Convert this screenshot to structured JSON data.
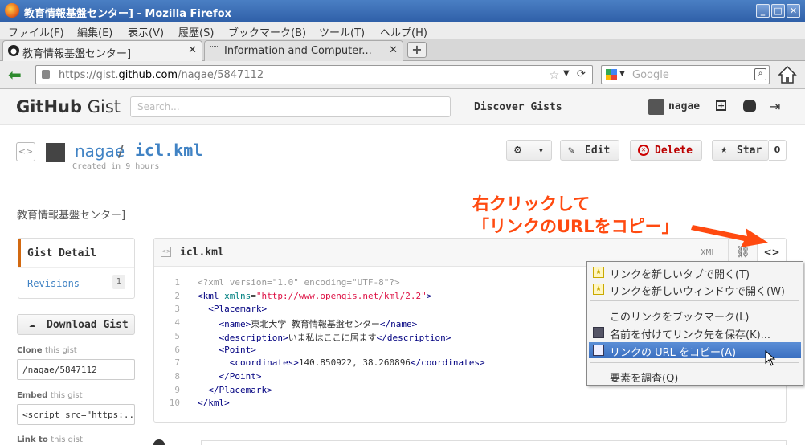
{
  "window": {
    "title": "教育情報基盤センター] - Mozilla Firefox"
  },
  "menubar": [
    "ファイル(F)",
    "編集(E)",
    "表示(V)",
    "履歴(S)",
    "ブックマーク(B)",
    "ツール(T)",
    "ヘルプ(H)"
  ],
  "tabs": [
    {
      "label": "教育情報基盤センター]",
      "active": true
    },
    {
      "label": "Information and Computer...",
      "active": false
    }
  ],
  "nav": {
    "url_prefix": "https://gist.",
    "url_host": "github.com",
    "url_path": "/nagae/5847112",
    "search_placeholder": "Google"
  },
  "github": {
    "logo_bold": "GitHub",
    "logo_light": " Gist",
    "search_placeholder": "Search...",
    "discover": "Discover Gists",
    "username": "nagae"
  },
  "gist": {
    "owner": "nagae",
    "separator": "/",
    "filename": "icl.kml",
    "created": "Created in 9 hours",
    "edit_label": "Edit",
    "delete_label": "Delete",
    "star_label": "Star",
    "star_count": "0",
    "description": "教育情報基盤センター]"
  },
  "sidebar": {
    "gist_detail": "Gist Detail",
    "revisions": "Revisions",
    "revisions_count": "1",
    "download": "Download Gist",
    "clone_label": "Clone",
    "clone_suffix": "this gist",
    "clone_value": "/nagae/5847112",
    "embed_label": "Embed",
    "embed_suffix": "this gist",
    "embed_value": "<script src=\"https:...",
    "link_label": "Link to",
    "link_suffix": "this gist"
  },
  "file": {
    "name": "icl.kml",
    "type": "XML",
    "lines": [
      "<?xml version=\"1.0\" encoding=\"UTF-8\"?>",
      "<kml xmlns=\"http://www.opengis.net/kml/2.2\">",
      "  <Placemark>",
      "    <name>東北大学 教育情報基盤センター</name>",
      "    <description>いま私はここに居ます</description>",
      "    <Point>",
      "      <coordinates>140.850922, 38.260896</coordinates>",
      "    </Point>",
      "  </Placemark>",
      "</kml>"
    ],
    "line_numbers": [
      "1",
      "2",
      "3",
      "4",
      "5",
      "6",
      "7",
      "8",
      "9",
      "10"
    ]
  },
  "annotation": {
    "line1": "右クリックして",
    "line2": "「リンクのURLをコピー」"
  },
  "context_menu": [
    {
      "label": "リンクを新しいタブで開く(T)"
    },
    {
      "label": "リンクを新しいウィンドウで開く(W)"
    },
    {
      "label": "このリンクをブックマーク(L)"
    },
    {
      "label": "名前を付けてリンク先を保存(K)..."
    },
    {
      "label": "リンクの URL をコピー(A)",
      "selected": true
    },
    {
      "label": "要素を調査(Q)"
    }
  ],
  "colors": {
    "accent_orange": "#ff4a10",
    "menu_highlight": "#3a6fc0",
    "link_blue": "#4183c4"
  }
}
